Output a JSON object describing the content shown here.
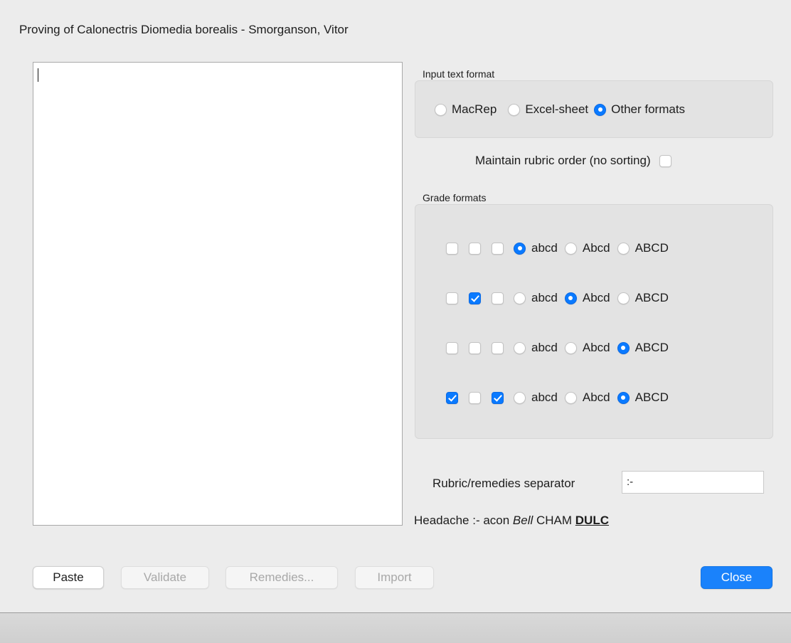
{
  "window": {
    "title": "Proving of Calonectris Diomedia borealis - Smorganson, Vitor"
  },
  "input_format": {
    "label": "Input text format",
    "options": [
      "MacRep",
      "Excel-sheet",
      "Other formats"
    ],
    "selected": "Other formats"
  },
  "maintain_order": {
    "label": "Maintain rubric order (no sorting)",
    "checked": false
  },
  "grade_formats": {
    "label": "Grade formats",
    "case_options": [
      "abcd",
      "Abcd",
      "ABCD"
    ],
    "rows": [
      {
        "checks": [
          false,
          false,
          false
        ],
        "selected": "abcd"
      },
      {
        "checks": [
          false,
          true,
          false
        ],
        "selected": "Abcd"
      },
      {
        "checks": [
          false,
          false,
          false
        ],
        "selected": "ABCD"
      },
      {
        "checks": [
          true,
          false,
          true
        ],
        "selected": "ABCD"
      }
    ]
  },
  "separator": {
    "label": "Rubric/remedies separator",
    "value": ":-"
  },
  "example": {
    "prefix": "Headache :- acon ",
    "italic": "Bell",
    "middle": " CHAM ",
    "bold_underline": "DULC"
  },
  "buttons": {
    "paste": "Paste",
    "validate": "Validate",
    "remedies": "Remedies...",
    "import": "Import",
    "close": "Close"
  },
  "colors": {
    "accent": "#0a7aff",
    "background": "#ececec"
  }
}
